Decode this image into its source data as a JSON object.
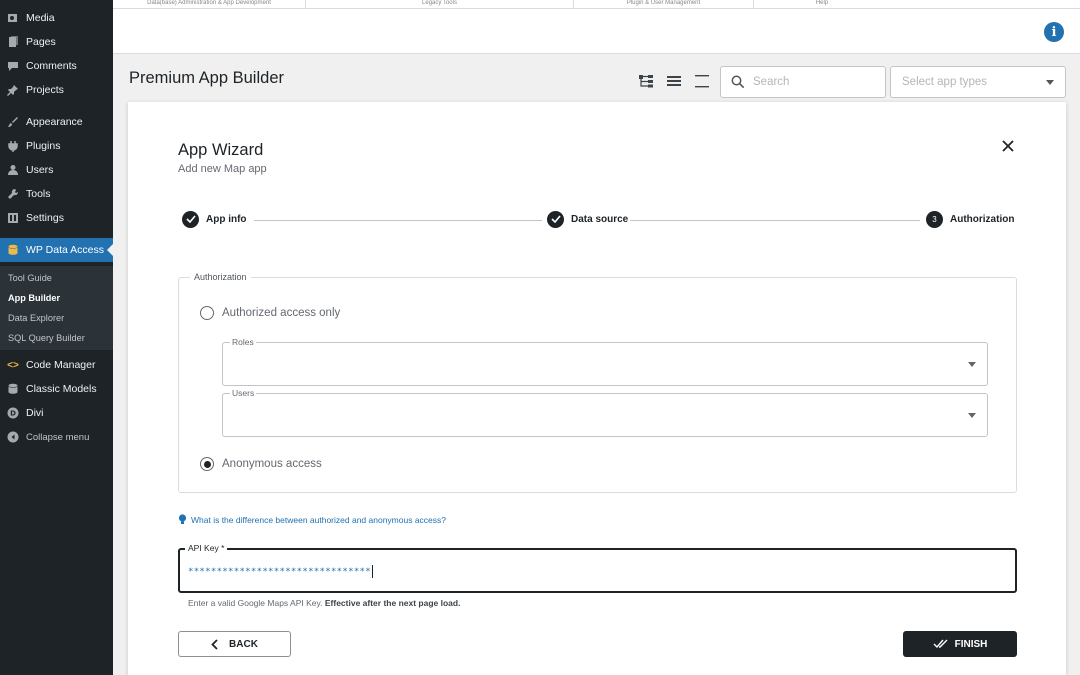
{
  "sidebar": {
    "items": [
      {
        "label": "Media",
        "icon": "media-icon"
      },
      {
        "label": "Pages",
        "icon": "pages-icon"
      },
      {
        "label": "Comments",
        "icon": "comments-icon"
      },
      {
        "label": "Projects",
        "icon": "pin-icon"
      },
      {
        "label": "Appearance",
        "icon": "brush-icon"
      },
      {
        "label": "Plugins",
        "icon": "plug-icon"
      },
      {
        "label": "Users",
        "icon": "user-icon"
      },
      {
        "label": "Tools",
        "icon": "wrench-icon"
      },
      {
        "label": "Settings",
        "icon": "settings-icon"
      },
      {
        "label": "WP Data Access",
        "icon": "database-icon"
      },
      {
        "label": "Code Manager",
        "icon": "code-icon"
      },
      {
        "label": "Classic Models",
        "icon": "database-icon"
      },
      {
        "label": "Divi",
        "icon": "divi-icon"
      },
      {
        "label": "Collapse menu",
        "icon": "collapse-icon"
      }
    ],
    "submenu": [
      "Tool Guide",
      "App Builder",
      "Data Explorer",
      "SQL Query Builder"
    ]
  },
  "topstrip": [
    "Data(base) Administration & App Development",
    "Legacy Tools",
    "Plugin & User Management",
    "Help"
  ],
  "header": {
    "title": "Premium App Builder",
    "search_placeholder": "Search",
    "type_placeholder": "Select app types"
  },
  "wizard": {
    "title": "App Wizard",
    "subtitle": "Add new Map app",
    "steps": [
      {
        "label": "App info",
        "num": ""
      },
      {
        "label": "Data source",
        "num": ""
      },
      {
        "label": "Authorization",
        "num": "3"
      }
    ],
    "legend": "Authorization",
    "option_authorized": "Authorized access only",
    "roles_label": "Roles",
    "users_label": "Users",
    "option_anonymous": "Anonymous access",
    "selected_option": "anonymous",
    "help_link": "What is the difference between authorized and anonymous access?",
    "api_label": "API Key *",
    "api_value": "********************************",
    "api_hint": "Enter a valid Google Maps API Key.",
    "api_hint_bold": "Effective after the next page load.",
    "back_label": "BACK",
    "finish_label": "FINISH"
  },
  "colors": {
    "sidebar_bg": "#1d2327",
    "active": "#2271b1",
    "accent_dark": "#1d2327"
  }
}
